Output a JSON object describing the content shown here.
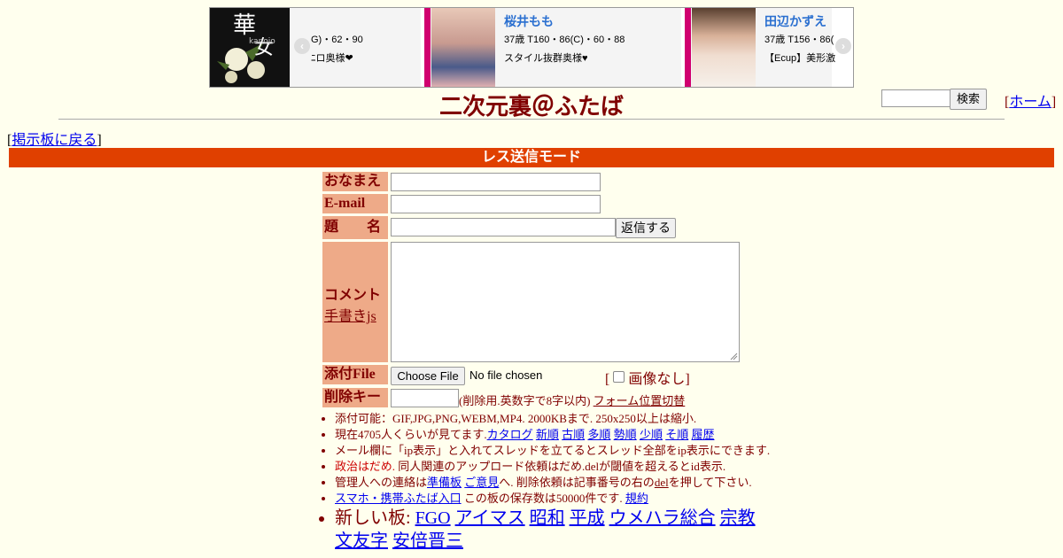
{
  "ad": {
    "logo_text": "華 女 kanojo",
    "cards": [
      {
        "name": "",
        "spec": "G)・62・90",
        "desc": "ﾆロ奥様❤"
      },
      {
        "name": "桜井もも",
        "spec": "37歳 T160・86(C)・60・88",
        "desc": "スタイル抜群奥様♥"
      },
      {
        "name": "田辺かずえ",
        "spec": "37歳 T156・86(",
        "desc": "【Ecup】美形激"
      }
    ],
    "prev_icon": "chevron-left-icon",
    "next_icon": "chevron-right-icon"
  },
  "header": {
    "title": "二次元裏＠ふたば",
    "search_button": "検索",
    "home_link": "ホーム",
    "back_link": "掲示板に戻る"
  },
  "form": {
    "mode": "レス送信モード",
    "labels": {
      "name": "おなまえ",
      "email": "E-mail",
      "subject": "題　　名",
      "comment": "コメント",
      "tegaki": "手書きjs",
      "file": "添付File",
      "delkey": "削除キー"
    },
    "reply_button": "返信する",
    "choose_file": "Choose File",
    "no_file": "No file chosen",
    "no_image": "画像なし",
    "delkey_note": "(削除用.英数字で8字以内)",
    "form_toggle": "フォーム位置切替"
  },
  "rules": {
    "r1": "添付可能：GIF,JPG,PNG,WEBM,MP4. 2000KBまで. 250x250以上は縮小.",
    "r2_prefix": "現在4705人くらいが見てます.",
    "r2_links": [
      "カタログ",
      "新順",
      "古順",
      "多順",
      "勢順",
      "少順",
      "そ順",
      "履歴"
    ],
    "r3": "メール欄に「ip表示」と入れてスレッドを立てるとスレッド全部をip表示にできます.",
    "r4_red": "政治はだめ.",
    "r4_rest": " 同人関連のアップロード依頼はだめ.delが閾値を超えるとid表示.",
    "r5_a": "管理人への連絡は",
    "r5_link1": "準備板",
    "r5_link2": "ご意見",
    "r5_b": "へ. 削除依頼は記事番号の右の",
    "r5_del": "del",
    "r5_c": "を押して下さい.",
    "r6_link": "スマホ・携帯ふたば入口",
    "r6_text": " この板の保存数は50000件です.",
    "r6_link2": "規約",
    "r7_label": "新しい板: ",
    "r7_links": [
      "FGO",
      "アイマス",
      "昭和",
      "平成",
      "ウメハラ総合",
      "宗教",
      "文友字",
      "安倍晋三"
    ]
  }
}
